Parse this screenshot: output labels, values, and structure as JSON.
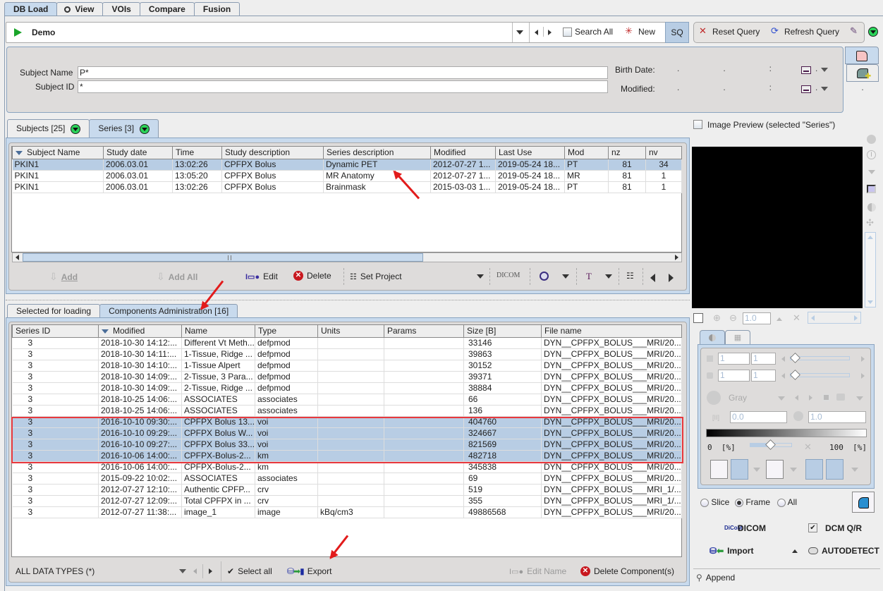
{
  "top_tabs": [
    {
      "label": "DB Load",
      "active": true
    },
    {
      "label": "View",
      "icon": "view-icon"
    },
    {
      "label": "VOIs"
    },
    {
      "label": "Compare"
    },
    {
      "label": "Fusion"
    }
  ],
  "query_bar": {
    "database": "Demo",
    "search_all_label": "Search All",
    "search_all_checked": false,
    "new_label": "New",
    "sq_label": "SQ",
    "reset_query_label": "Reset Query",
    "refresh_query_label": "Refresh Query"
  },
  "subject_filter": {
    "subject_name_label": "Subject Name",
    "subject_name_value": "P*",
    "subject_id_label": "Subject ID",
    "subject_id_value": "*",
    "birth_date_label": "Birth Date:",
    "modified_label": "Modified:",
    "date_placeholder": ".      .      :      .      ."
  },
  "list_tabs": [
    {
      "label": "Subjects [25]"
    },
    {
      "label": "Series [3]",
      "active": true
    }
  ],
  "series_table": {
    "columns": [
      "Subject Name",
      "Study date",
      "Time",
      "Study description",
      "Series description",
      "Modified",
      "Last Use",
      "Mod",
      "nz",
      "nv"
    ],
    "rows": [
      {
        "cells": [
          "PKIN1",
          "2006.03.01",
          "13:02:26",
          "CPFPX Bolus",
          "Dynamic PET",
          "2012-07-27 1...",
          "2019-05-24 18...",
          "PT",
          "81",
          "34"
        ],
        "selected": true
      },
      {
        "cells": [
          "PKIN1",
          "2006.03.01",
          "13:05:20",
          "CPFPX Bolus",
          "MR Anatomy",
          "2012-07-27 1...",
          "2019-05-24 18...",
          "MR",
          "81",
          "1"
        ]
      },
      {
        "cells": [
          "PKIN1",
          "2006.03.01",
          "13:02:26",
          "CPFPX Bolus",
          "Brainmask",
          "2015-03-03 1...",
          "2019-05-24 18...",
          "PT",
          "81",
          "1"
        ]
      }
    ]
  },
  "series_toolbar": {
    "add": "Add",
    "add_all": "Add All",
    "edit": "Edit",
    "delete": "Delete",
    "set_project": "Set Project",
    "dicom": "DICOM",
    "text_tool": "T"
  },
  "lower_tabs": [
    {
      "label": "Selected for loading"
    },
    {
      "label": "Components Administration [16]",
      "active": true
    }
  ],
  "components_table": {
    "columns": [
      "Series ID",
      "Modified",
      "Name",
      "Type",
      "Units",
      "Params",
      "Size [B]",
      "File name"
    ],
    "rows": [
      {
        "cells": [
          "3",
          "2018-10-30 14:12:...",
          "Different Vt Meth...",
          "defpmod",
          "",
          "",
          "33146",
          "DYN__CPFPX_BOLUS___MRI/20..."
        ]
      },
      {
        "cells": [
          "3",
          "2018-10-30 14:11:...",
          "1-Tissue, Ridge ...",
          "defpmod",
          "",
          "",
          "39863",
          "DYN__CPFPX_BOLUS___MRI/20..."
        ]
      },
      {
        "cells": [
          "3",
          "2018-10-30 14:10:...",
          "1-Tissue Alpert",
          "defpmod",
          "",
          "",
          "30152",
          "DYN__CPFPX_BOLUS___MRI/20..."
        ]
      },
      {
        "cells": [
          "3",
          "2018-10-30 14:09:...",
          "2-Tissue, 3 Para...",
          "defpmod",
          "",
          "",
          "39371",
          "DYN__CPFPX_BOLUS___MRI/20..."
        ]
      },
      {
        "cells": [
          "3",
          "2018-10-30 14:09:...",
          "2-Tissue, Ridge ...",
          "defpmod",
          "",
          "",
          "38884",
          "DYN__CPFPX_BOLUS___MRI/20..."
        ]
      },
      {
        "cells": [
          "3",
          "2018-10-25 14:06:...",
          "ASSOCIATES",
          "associates",
          "",
          "",
          "66",
          "DYN__CPFPX_BOLUS___MRI/20..."
        ]
      },
      {
        "cells": [
          "3",
          "2018-10-25 14:06:...",
          "ASSOCIATES",
          "associates",
          "",
          "",
          "136",
          "DYN__CPFPX_BOLUS___MRI/20..."
        ]
      },
      {
        "cells": [
          "3",
          "2016-10-10 09:30:...",
          "CPFPX Bolus 13...",
          "voi",
          "",
          "",
          "404760",
          "DYN__CPFPX_BOLUS___MRI/20..."
        ],
        "selected": true
      },
      {
        "cells": [
          "3",
          "2016-10-10 09:29:...",
          "CPFPX Bolus W...",
          "voi",
          "",
          "",
          "324667",
          "DYN__CPFPX_BOLUS___MRI/20..."
        ],
        "selected": true
      },
      {
        "cells": [
          "3",
          "2016-10-10 09:27:...",
          "CPFPX Bolus 33...",
          "voi",
          "",
          "",
          "821569",
          "DYN__CPFPX_BOLUS___MRI/20..."
        ],
        "selected": true
      },
      {
        "cells": [
          "3",
          "2016-10-06 14:00:...",
          "CPFPX-Bolus-2...",
          "km",
          "",
          "",
          "482718",
          "DYN__CPFPX_BOLUS___MRI/20..."
        ],
        "selected": true
      },
      {
        "cells": [
          "3",
          "2016-10-06 14:00:...",
          "CPFPX-Bolus-2...",
          "km",
          "",
          "",
          "345838",
          "DYN__CPFPX_BOLUS___MRI/20..."
        ]
      },
      {
        "cells": [
          "3",
          "2015-09-22 10:02:...",
          "ASSOCIATES",
          "associates",
          "",
          "",
          "69",
          "DYN__CPFPX_BOLUS___MRI/20..."
        ]
      },
      {
        "cells": [
          "3",
          "2012-07-27 12:10:...",
          "Authentic CPFP...",
          "crv",
          "",
          "",
          "519",
          "DYN__CPFPX_BOLUS___MRI_1/..."
        ]
      },
      {
        "cells": [
          "3",
          "2012-07-27 12:09:...",
          "Total CPFPX in ...",
          "crv",
          "",
          "",
          "355",
          "DYN__CPFPX_BOLUS___MRI_1/..."
        ]
      },
      {
        "cells": [
          "3",
          "2012-07-27 11:38:...",
          "image_1",
          "image",
          "kBq/cm3",
          "",
          "49886568",
          "DYN__CPFPX_BOLUS___MRI/20..."
        ]
      }
    ]
  },
  "components_toolbar": {
    "data_type_filter": "ALL DATA TYPES (*)",
    "select_all": "Select all",
    "export": "Export",
    "edit_name": "Edit Name",
    "delete_components": "Delete Component(s)"
  },
  "preview": {
    "image_preview_label": "Image Preview (selected \"Series\")",
    "image_preview_checked": false,
    "zoom_value": "1.0",
    "slice_from": "1",
    "slice_to": "1",
    "frame_from": "1",
    "frame_to": "1",
    "colormap": "Gray",
    "min_value": "0.0",
    "max_value": "1.0",
    "range_min_label": "0  [%]",
    "range_max_label": "100  [%]",
    "range_slider_fraction": 0.5
  },
  "load_options": {
    "radio": [
      {
        "label": "Slice",
        "checked": false
      },
      {
        "label": "Frame",
        "checked": true
      },
      {
        "label": "All",
        "checked": false
      }
    ],
    "dicom_label": "DICOM",
    "dcm_qr_label": "DCM Q/R",
    "dcm_qr_checked": true,
    "import_label": "Import",
    "autodetect_label": "AUTODETECT",
    "append_label": "Append"
  },
  "colors": {
    "selection": "#b8cde4",
    "active_tab": "#c8daed",
    "highlight_box": "#e8383d",
    "annotation_arrow": "#e21b1b"
  }
}
